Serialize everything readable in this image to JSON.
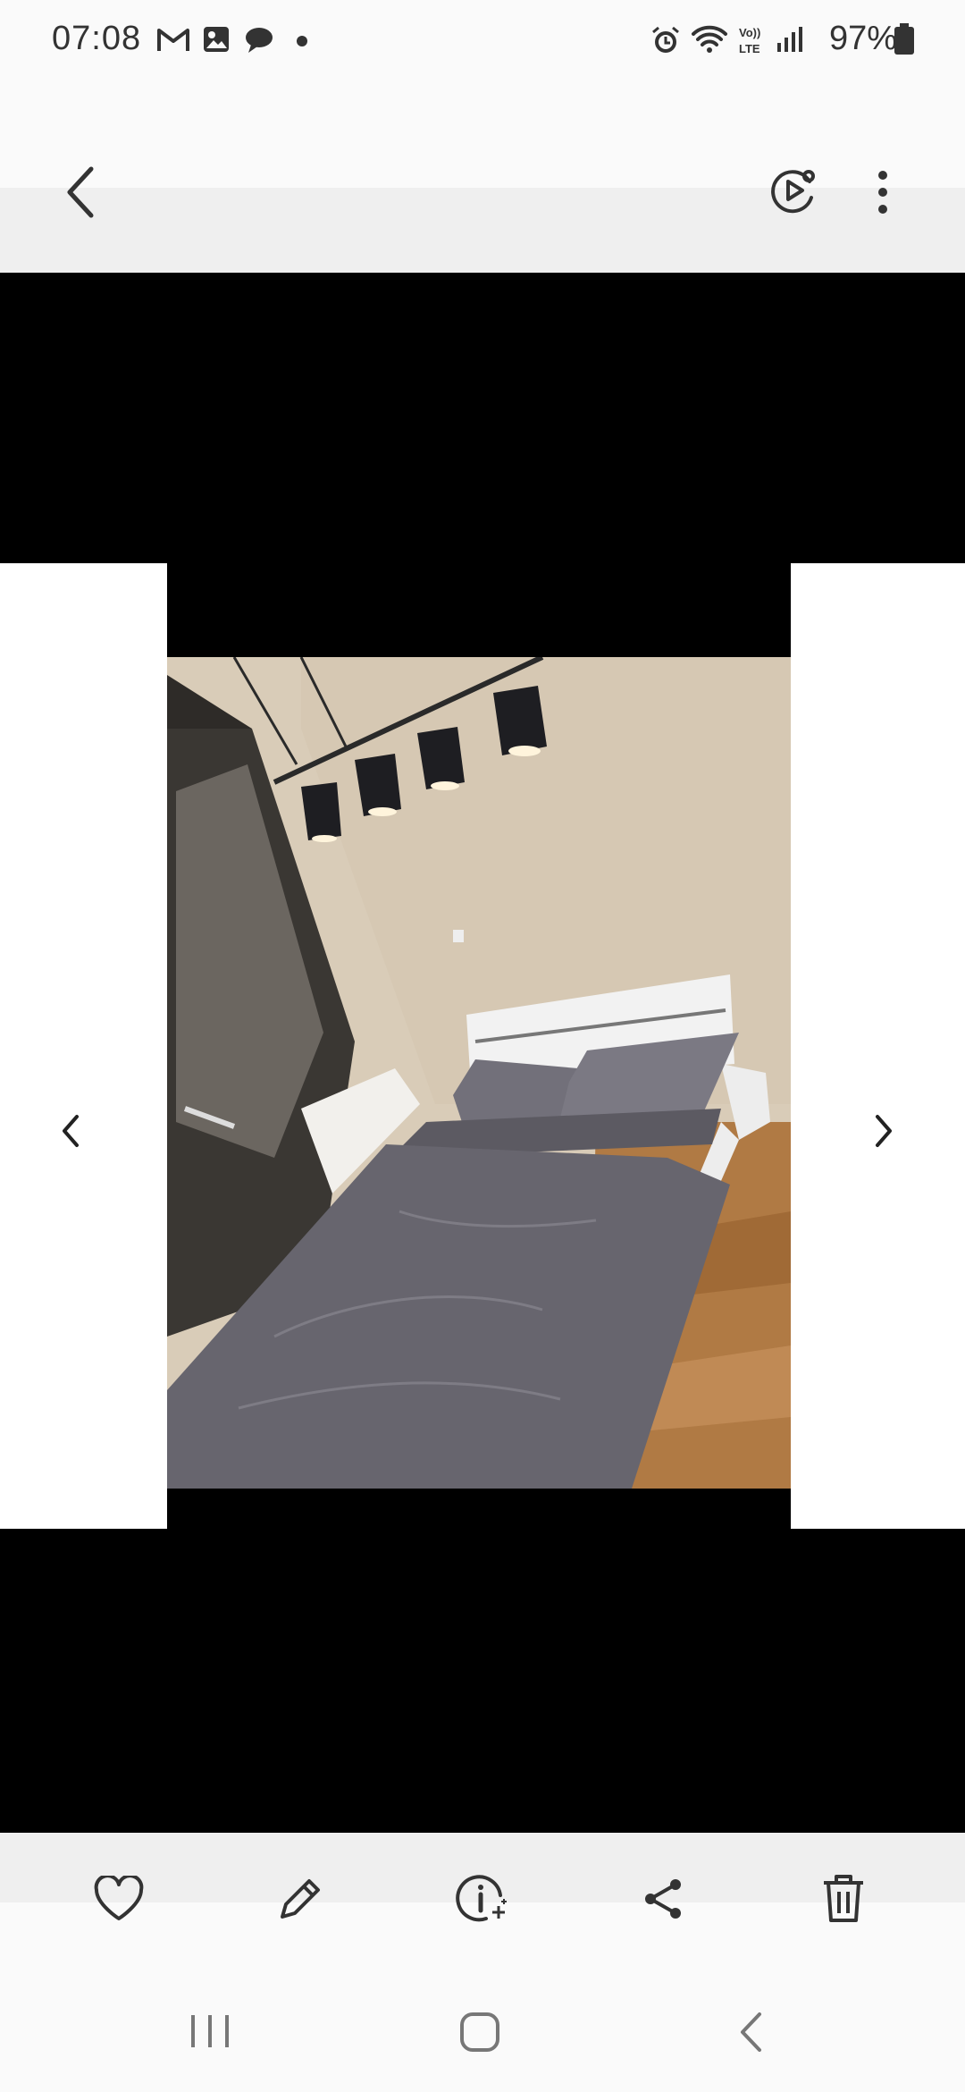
{
  "status_bar": {
    "time": "07:08",
    "battery_percent": "97%",
    "icons": [
      "gmail-icon",
      "gallery-icon",
      "chat-bubble-icon",
      "dot-icon",
      "alarm-icon",
      "wifi-icon",
      "volte-icon",
      "signal-icon",
      "battery-icon"
    ]
  },
  "top_bar": {
    "back": "back-icon",
    "slideshow": "slideshow-play-icon",
    "more": "more-options-icon"
  },
  "viewer": {
    "image_description": "bedroom-photo",
    "prev": "chevron-left-icon",
    "next": "chevron-right-icon"
  },
  "action_bar": [
    "favorite-heart-icon",
    "edit-pencil-icon",
    "info-icon",
    "share-icon",
    "delete-trash-icon"
  ],
  "nav_bar": [
    "recent-apps-icon",
    "home-icon",
    "back-nav-icon"
  ],
  "colors": {
    "background": "#fafafa",
    "viewer_bg": "#000000",
    "icon": "#333333"
  }
}
